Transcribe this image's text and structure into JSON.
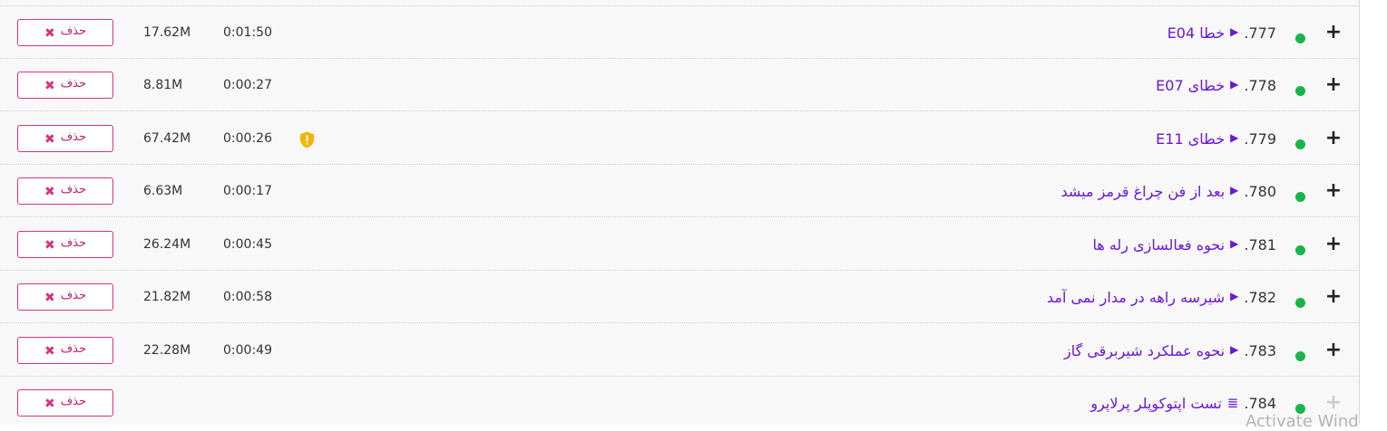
{
  "delete_label": "حذف",
  "status_color": "#1ab44a",
  "watermark": "Activate Wind",
  "rows": [
    {
      "num": ".777",
      "title": "خطا E04",
      "type_icon": "play-icon",
      "duration": "0:01:50",
      "size": "17.62M",
      "warning": false,
      "expandable": true
    },
    {
      "num": ".778",
      "title": "خطای E07",
      "type_icon": "play-icon",
      "duration": "0:00:27",
      "size": "8.81M",
      "warning": false,
      "expandable": true
    },
    {
      "num": ".779",
      "title": "خطای E11",
      "type_icon": "play-icon",
      "duration": "0:00:26",
      "size": "67.42M",
      "warning": true,
      "expandable": true
    },
    {
      "num": ".780",
      "title": "بعد از فن چراغ قرمز میشد",
      "type_icon": "play-icon",
      "duration": "0:00:17",
      "size": "6.63M",
      "warning": false,
      "expandable": true
    },
    {
      "num": ".781",
      "title": "نحوه فعالسازی رله ها",
      "type_icon": "play-icon",
      "duration": "0:00:45",
      "size": "26.24M",
      "warning": false,
      "expandable": true
    },
    {
      "num": ".782",
      "title": "شیرسه راهه در مدار نمی آمد",
      "type_icon": "play-icon",
      "duration": "0:00:58",
      "size": "21.82M",
      "warning": false,
      "expandable": true
    },
    {
      "num": ".783",
      "title": "نحوه عملکرد شیربرقی گاز",
      "type_icon": "play-icon",
      "duration": "0:00:49",
      "size": "22.28M",
      "warning": false,
      "expandable": true
    },
    {
      "num": ".784",
      "title": "تست اپتوکوپلر پرلاپرو",
      "type_icon": "text-lines-icon",
      "duration": "",
      "size": "",
      "warning": false,
      "expandable": false
    }
  ]
}
